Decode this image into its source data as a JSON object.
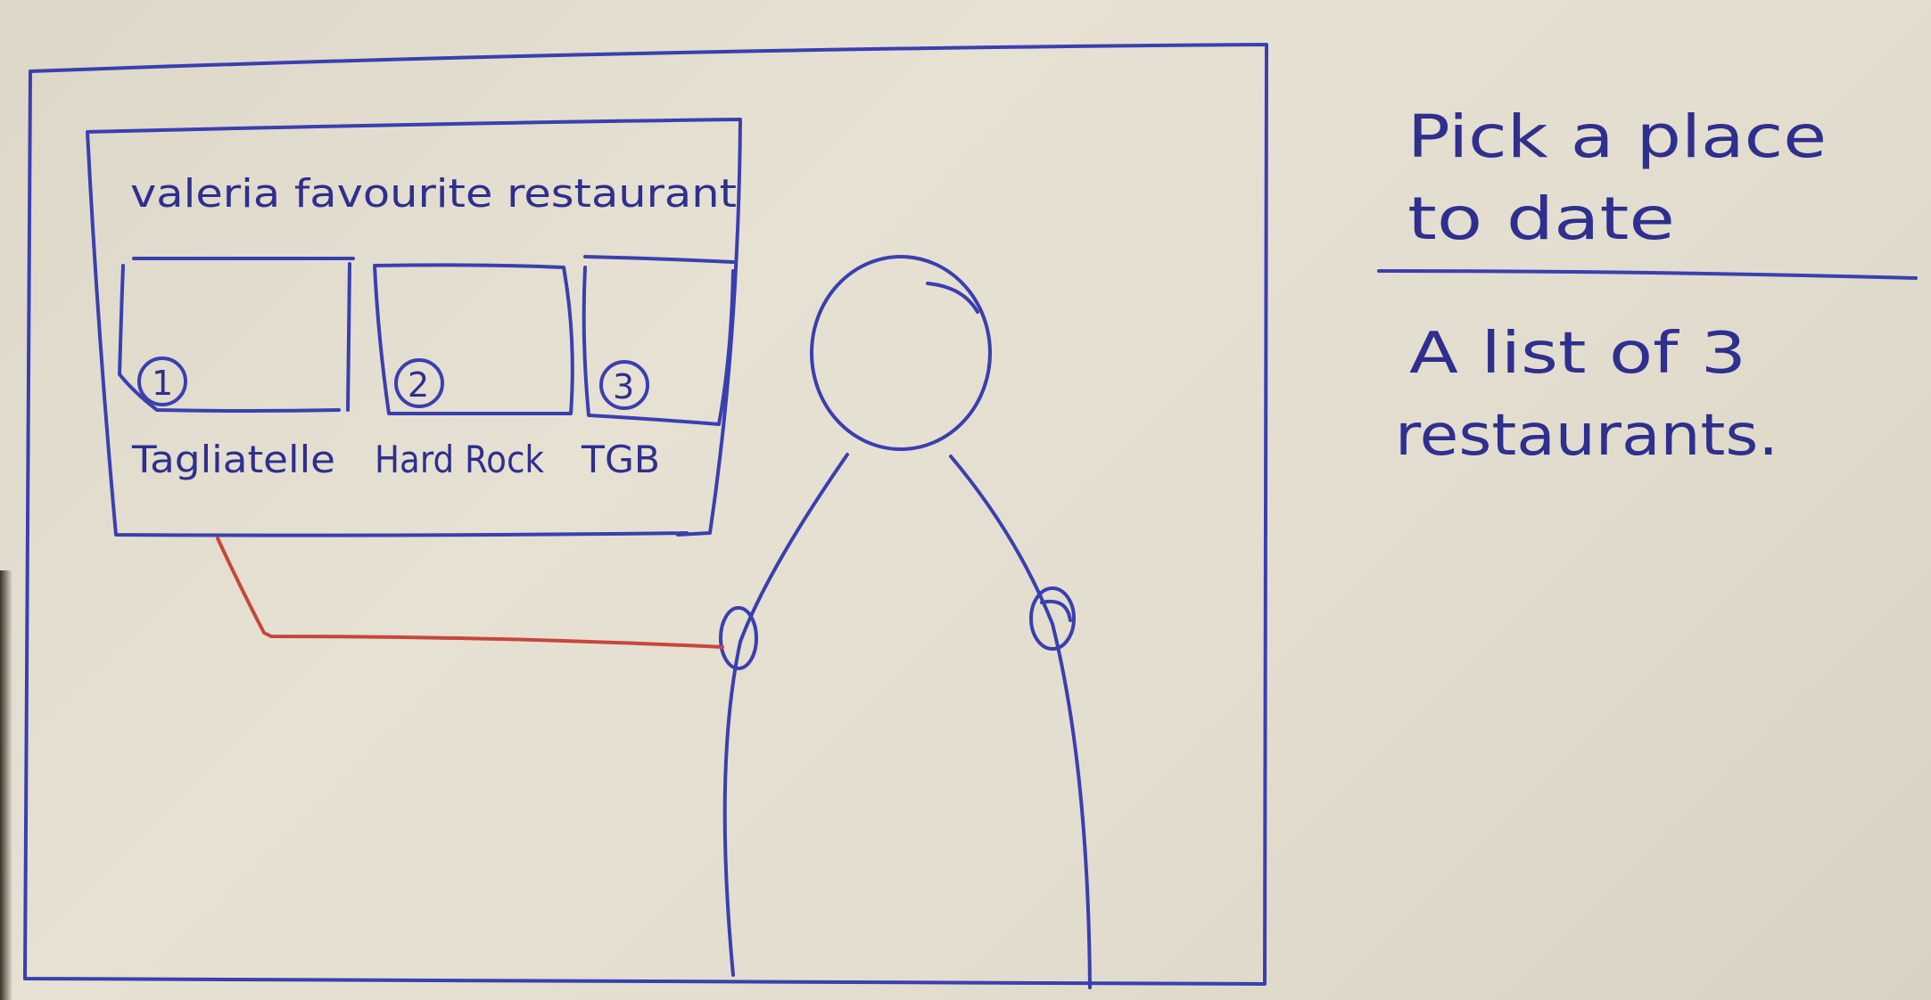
{
  "screen": {
    "title": "valeria favourite restaurant",
    "restaurants": [
      {
        "number": "1",
        "name": "Tagliatelle"
      },
      {
        "number": "2",
        "name": "Hard Rock"
      },
      {
        "number": "3",
        "name": "TGB"
      }
    ]
  },
  "notes": {
    "heading_line1": "Pick a place",
    "heading_line2": "to date",
    "description_line1": "A list of 3",
    "description_line2": "restaurants."
  },
  "colors": {
    "ink": "#3a3fb0",
    "connector": "#c8463c",
    "paper": "#e3ddcf"
  }
}
